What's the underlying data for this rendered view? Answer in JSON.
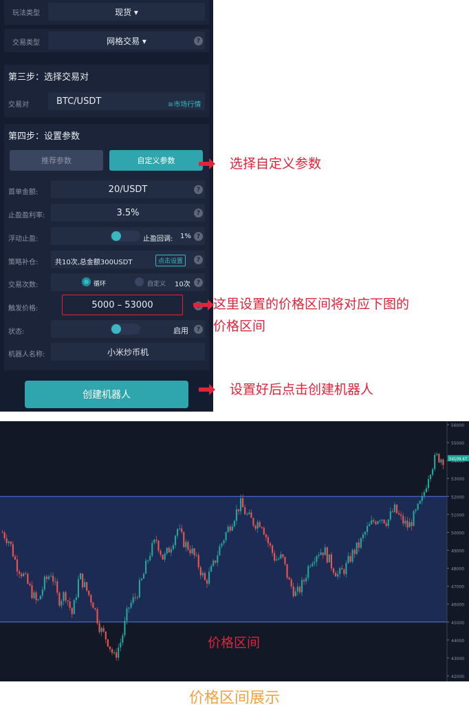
{
  "form": {
    "play_type_label": "玩法类型",
    "play_type_value": "现货 ▾",
    "trade_type_label": "交易类型",
    "trade_type_value": "网格交易 ▾",
    "step3_title": "第三步：选择交易对",
    "pair_label": "交易对",
    "pair_value": "BTC/USDT",
    "market_link": "≋市场行情",
    "step4_title": "第四步：设置参数",
    "tab_recommended": "推荐参数",
    "tab_custom": "自定义参数",
    "first_amount_label": "首单金额:",
    "first_amount_value": "20/USDT",
    "take_profit_label": "止盈盈利率:",
    "take_profit_value": "3.5%",
    "float_tp_label": "浮动止盈:",
    "tp_pullback_label": "止盈回调:",
    "tp_pullback_value": "1%",
    "dca_label": "策略补仓:",
    "dca_value": "共10次,总金额300USDT",
    "dca_button": "点击设置",
    "trade_count_label": "交易次数:",
    "loop_option": "循环",
    "custom_option": "自定义",
    "count_value": "10次",
    "trigger_label": "触发价格:",
    "trigger_value": "5000  –  53000",
    "status_label": "状态:",
    "enable_label": "启用",
    "bot_name_label": "机器人名称:",
    "bot_name_value": "小米炒币机",
    "create_button": "创建机器人",
    "help_mark": "?"
  },
  "annotations": {
    "custom_params": "选择自定义参数",
    "price_range_1": "这里设置的价格区间将对应下图的",
    "price_range_2": "价格区间",
    "create_bot": "设置好后点击创建机器人"
  },
  "chart_data": {
    "type": "candlestick",
    "ylim": [
      42000,
      56000
    ],
    "y_ticks": [
      "56000",
      "55000",
      "54000",
      "53000",
      "52000",
      "51000",
      "50000",
      "49000",
      "48000",
      "47000",
      "46000",
      "45000",
      "44000",
      "43000",
      "42000"
    ],
    "current_price_label": "54109.47",
    "range_band": {
      "low": 45000,
      "high": 52000
    },
    "band_label": "价格区间",
    "trend_closes": [
      50000,
      49500,
      48200,
      47600,
      46800,
      46000,
      47200,
      47800,
      46200,
      46600,
      45400,
      47600,
      46800,
      46000,
      44600,
      44000,
      43000,
      44000,
      45800,
      46400,
      47400,
      48800,
      49600,
      48500,
      49200,
      50200,
      49400,
      49000,
      48200,
      47200,
      48000,
      49100,
      50000,
      50800,
      51600,
      50900,
      50500,
      50600,
      49400,
      48500,
      48600,
      47200,
      46500,
      47200,
      48400,
      48900,
      49000,
      48200,
      47600,
      48000,
      48800,
      49300,
      50100,
      50600,
      50900,
      50600,
      51300,
      50700,
      50300,
      51000,
      51800,
      53400,
      54200,
      54100
    ]
  },
  "caption": "价格区间展示"
}
